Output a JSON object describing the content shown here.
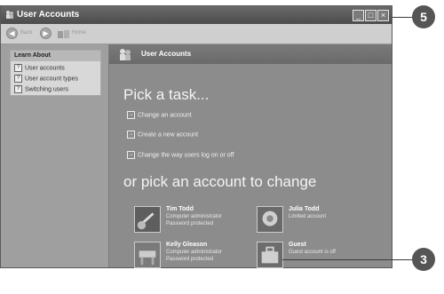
{
  "window": {
    "title": "User Accounts",
    "min": "_",
    "max": "□",
    "close": "×"
  },
  "toolbar": {
    "back": "Back",
    "forward": "",
    "home": "Home"
  },
  "sidebar": {
    "heading": "Learn About",
    "items": [
      {
        "label": "User accounts"
      },
      {
        "label": "User account types"
      },
      {
        "label": "Switching users"
      }
    ]
  },
  "main": {
    "header_title": "User Accounts",
    "pick_task": "Pick a task...",
    "tasks": [
      {
        "label": "Change an account"
      },
      {
        "label": "Create a new account"
      },
      {
        "label": "Change the way users log on or off"
      }
    ],
    "pick_account": "or pick an account to change",
    "accounts": [
      {
        "name": "Tim Todd",
        "line1": "Computer administrator",
        "line2": "Password protected"
      },
      {
        "name": "Julia Todd",
        "line1": "Limited account",
        "line2": ""
      },
      {
        "name": "Kelly Gleason",
        "line1": "Computer administrator",
        "line2": "Password protected"
      },
      {
        "name": "Guest",
        "line1": "Guest account is off",
        "line2": ""
      }
    ]
  },
  "callouts": {
    "top": "5",
    "bottom": "3"
  },
  "colors": {
    "callout": "#555555",
    "window_bg": "#8e8e8e"
  }
}
